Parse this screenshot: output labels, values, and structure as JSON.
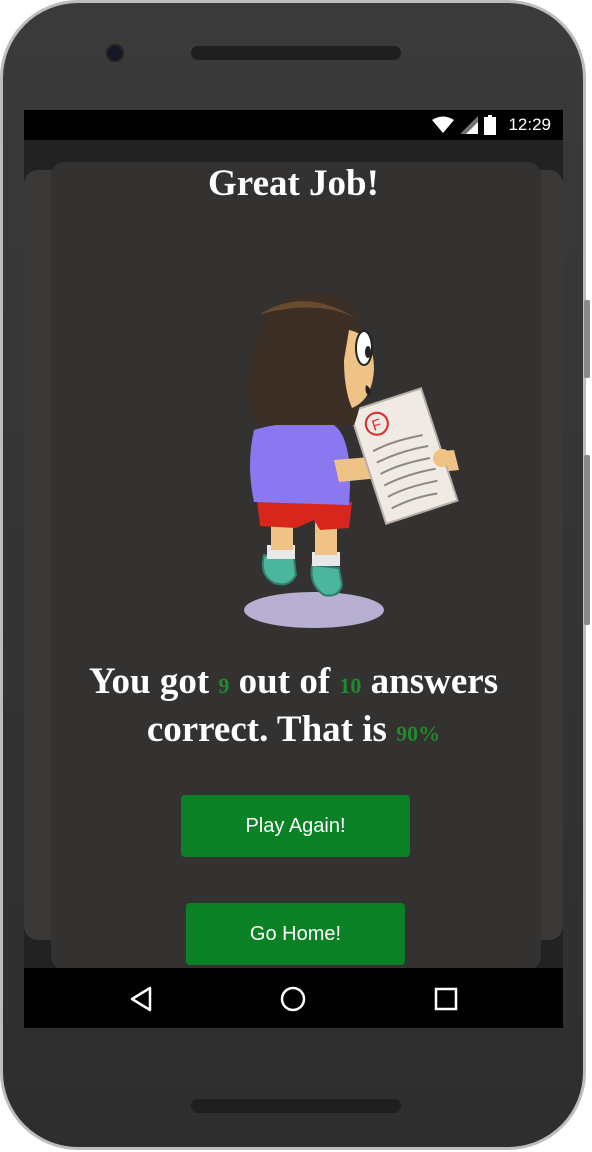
{
  "status_bar": {
    "time": "12:29",
    "icons": [
      "wifi-icon",
      "signal-icon",
      "battery-icon"
    ]
  },
  "result_screen": {
    "title": "Great Job!",
    "illustration": "child-holding-failed-test-paper",
    "result_line": {
      "prefix": "You got",
      "correct": "9",
      "middle": "out of",
      "total": "10",
      "suffix1": "answers",
      "suffix2": "correct. That is",
      "percent": "90%"
    },
    "play_again_label": "Play Again!",
    "go_home_label": "Go Home!"
  },
  "nav_bar": {
    "icons": [
      "back-icon",
      "home-icon",
      "recents-icon"
    ]
  },
  "colors": {
    "background": "#343131",
    "accent_green": "#0b8125",
    "number_green": "#1f8a2e",
    "text": "#ffffff"
  }
}
